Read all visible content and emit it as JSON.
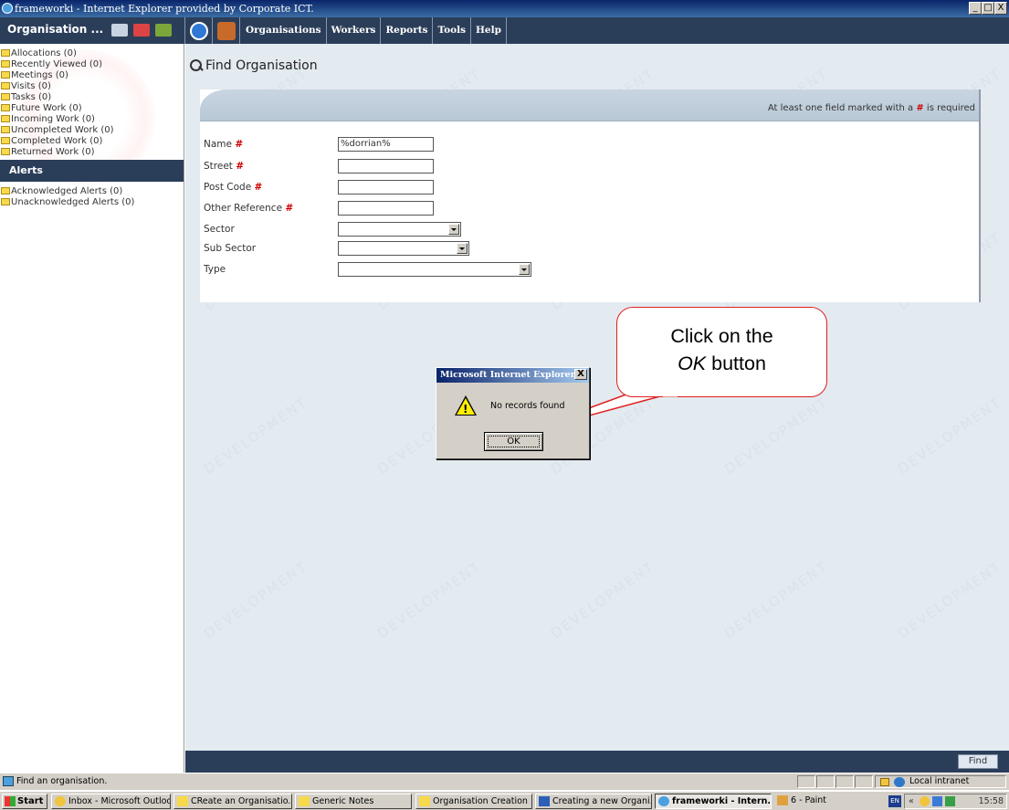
{
  "window": {
    "title": "frameworki - Internet Explorer provided by Corporate ICT.",
    "controls": [
      "_",
      "□",
      "X"
    ]
  },
  "toolbar": {
    "app_title": "Organisation ...",
    "menu": [
      "Organisations",
      "Workers",
      "Reports",
      "Tools",
      "Help"
    ]
  },
  "sidebar": {
    "work_items": [
      "Allocations (0)",
      "Recently Viewed (0)",
      "Meetings (0)",
      "Visits (0)",
      "Tasks (0)",
      "Future Work (0)",
      "Incoming Work (0)",
      "Uncompleted Work (0)",
      "Completed Work (0)",
      "Returned Work (0)"
    ],
    "alerts_header": "Alerts",
    "alert_items": [
      "Acknowledged Alerts (0)",
      "Unacknowledged Alerts (0)"
    ]
  },
  "main": {
    "title": "Find Organisation",
    "required_note_pre": "At least one field marked with a",
    "required_note_hash": "#",
    "required_note_post": "is required",
    "watermark": "DEVELOPMENT",
    "fields": [
      {
        "label": "Name",
        "required": "#",
        "value": "%dorrian%"
      },
      {
        "label": "Street",
        "required": "#",
        "value": ""
      },
      {
        "label": "Post Code",
        "required": "#",
        "value": ""
      },
      {
        "label": "Other Reference",
        "required": "#",
        "value": ""
      },
      {
        "label": "Sector",
        "value": ""
      },
      {
        "label": "Sub Sector",
        "value": ""
      },
      {
        "label": "Type",
        "value": ""
      }
    ],
    "find_button": "Find"
  },
  "dialog": {
    "title": "Microsoft Internet Explorer",
    "close": "X",
    "warn_glyph": "!",
    "message": "No records found",
    "ok": "OK"
  },
  "callout": {
    "line1": "Click on the",
    "line2_italic": "OK",
    "line2_rest": " button",
    "border_color": "#e02020"
  },
  "statusbar": {
    "text": "Find an organisation.",
    "zone": "Local intranet"
  },
  "taskbar": {
    "start": "Start",
    "tasks": [
      "Inbox - Microsoft Outlook",
      "CReate an Organisatio...",
      "Generic Notes",
      "Organisation Creation",
      "Creating a new Organi...",
      "frameworki - Intern...",
      "6 - Paint"
    ],
    "lang": "EN",
    "clock": "15:58"
  }
}
